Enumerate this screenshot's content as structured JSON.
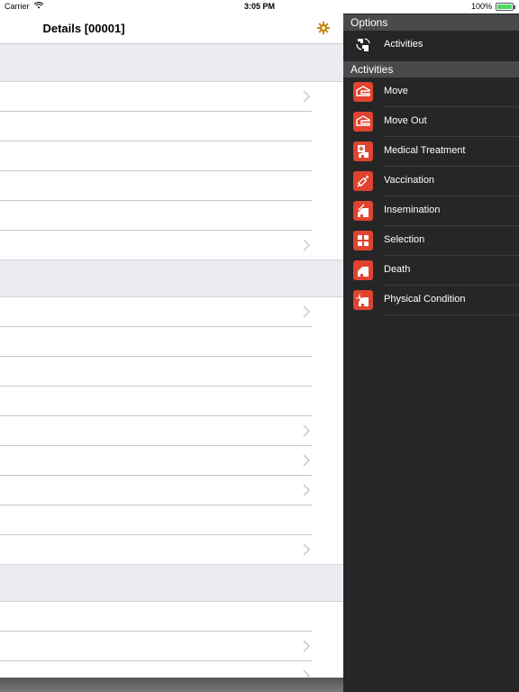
{
  "status_bar": {
    "carrier": "Carrier",
    "time": "3:05 PM",
    "battery": "100%",
    "wifi_icon": "wifi-icon",
    "battery_icon": "battery-icon"
  },
  "main": {
    "title": "Details [00001]",
    "settings_icon": "gear-icon",
    "accent_color": "#c58a1c"
  },
  "side": {
    "options_header": "Options",
    "options_items": [
      {
        "label": "Activities",
        "icon": "activities-icon"
      }
    ],
    "activities_header": "Activities",
    "activities_items": [
      {
        "label": "Move",
        "icon": "move-icon"
      },
      {
        "label": "Move Out",
        "icon": "move-out-icon"
      },
      {
        "label": "Medical Treatment",
        "icon": "medical-treatment-icon"
      },
      {
        "label": "Vaccination",
        "icon": "syringe-icon"
      },
      {
        "label": "Insemination",
        "icon": "insemination-icon"
      },
      {
        "label": "Selection",
        "icon": "selection-icon"
      },
      {
        "label": "Death",
        "icon": "death-icon"
      },
      {
        "label": "Physical Condition",
        "icon": "physical-condition-icon"
      }
    ],
    "icon_color": "#e0432f",
    "background_color": "#262626"
  }
}
